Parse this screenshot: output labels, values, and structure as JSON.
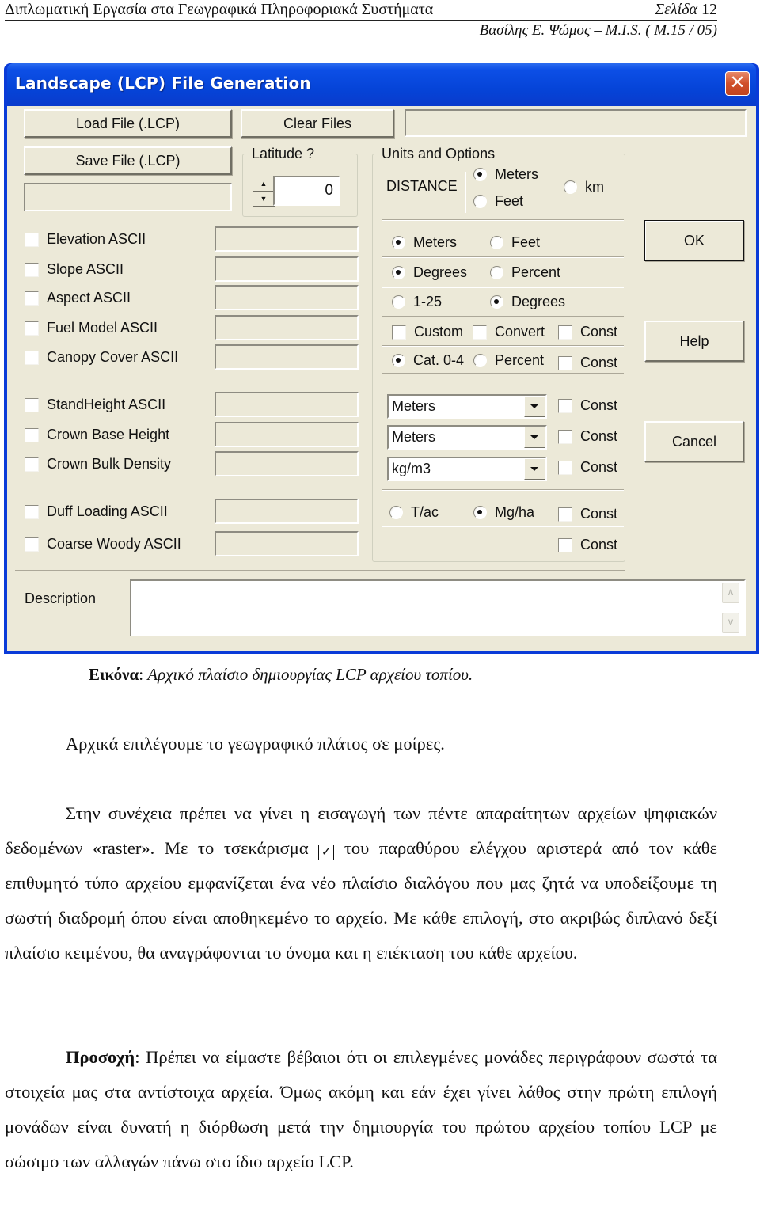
{
  "header": {
    "doc_title": "Διπλωματική Εργασία στα Γεωγραφικά Πληροφοριακά Συστήματα",
    "page_label": "Σελίδα",
    "page_number": "12",
    "author_line": "Βασίλης Ε. Ψώμος – M.I.S. ( M.15 / 05)"
  },
  "dialog": {
    "title": "Landscape (LCP) File Generation",
    "close_icon": "close-x-icon",
    "buttons": {
      "load": "Load File (.LCP)",
      "clear": "Clear Files",
      "save": "Save File (.LCP)",
      "ok": "OK",
      "help": "Help",
      "cancel": "Cancel"
    },
    "file_path_value": "",
    "status_value": "",
    "latitude": {
      "label": "Latitude ?",
      "value": "0",
      "up_icon": "spin-up-icon",
      "down_icon": "spin-down-icon"
    },
    "units": {
      "label": "Units and Options",
      "distance_label": "DISTANCE",
      "distance_options": [
        {
          "label": "Meters",
          "selected": true
        },
        {
          "label": "Feet",
          "selected": false
        },
        {
          "label": "km",
          "selected": false
        }
      ],
      "elevation": [
        {
          "label": "Meters",
          "selected": true
        },
        {
          "label": "Feet",
          "selected": false
        }
      ],
      "slope": [
        {
          "label": "Degrees",
          "selected": true
        },
        {
          "label": "Percent",
          "selected": false
        }
      ],
      "aspect": [
        {
          "label": "1-25",
          "selected": false
        },
        {
          "label": "Degrees",
          "selected": true
        }
      ],
      "fuel": [
        {
          "label": "Custom",
          "checked": false
        },
        {
          "label": "Convert",
          "checked": false
        },
        {
          "label": "Const",
          "checked": false
        }
      ],
      "canopy": {
        "options": [
          {
            "label": "Cat. 0-4",
            "selected": true
          },
          {
            "label": "Percent",
            "selected": false
          }
        ],
        "const": {
          "label": "Const",
          "checked": false
        }
      },
      "stand_height": {
        "unit": "Meters",
        "const": "Const"
      },
      "crown_base": {
        "unit": "Meters",
        "const": "Const"
      },
      "crown_bulk": {
        "unit": "kg/m3",
        "const": "Const"
      },
      "duff": {
        "options": [
          {
            "label": "T/ac",
            "selected": false
          },
          {
            "label": "Mg/ha",
            "selected": true
          }
        ],
        "const": "Const"
      },
      "coarse_woody": {
        "const": "Const"
      }
    },
    "layers": [
      {
        "label": "Elevation ASCII",
        "checked": false,
        "file": ""
      },
      {
        "label": "Slope ASCII",
        "checked": false,
        "file": ""
      },
      {
        "label": "Aspect ASCII",
        "checked": false,
        "file": ""
      },
      {
        "label": "Fuel Model ASCII",
        "checked": false,
        "file": ""
      },
      {
        "label": "Canopy Cover ASCII",
        "checked": false,
        "file": ""
      },
      {
        "label": "StandHeight ASCII",
        "checked": false,
        "file": ""
      },
      {
        "label": "Crown Base Height",
        "checked": false,
        "file": ""
      },
      {
        "label": "Crown Bulk Density",
        "checked": false,
        "file": ""
      },
      {
        "label": "Duff Loading ASCII",
        "checked": false,
        "file": ""
      },
      {
        "label": "Coarse Woody ASCII",
        "checked": false,
        "file": ""
      }
    ],
    "description": {
      "label": "Description",
      "value": "",
      "scroll_up_icon": "chevron-up-icon",
      "scroll_down_icon": "chevron-down-icon"
    }
  },
  "caption": {
    "label": "Εικόνα",
    "text": "Αρχικό  πλαίσιο δημιουργίας LCP αρχείου τοπίου."
  },
  "body": {
    "p1": "Αρχικά επιλέγουμε το γεωγραφικό πλάτος σε μοίρες.",
    "p2_a": "Στην συνέχεια πρέπει να γίνει η εισαγωγή των πέντε απαραίτητων αρχείων ψηφιακών δεδομένων «raster». Με το τσεκάρισμα",
    "p2_check_icon": "☑",
    "p2_b": "του παραθύρου ελέγχου αριστερά από τον κάθε επιθυμητό τύπο αρχείου εμφανίζεται ένα νέο πλαίσιο διαλόγου που μας ζητά να υποδείξουμε τη σωστή διαδρομή όπου είναι αποθηκεμένο το αρχείο. Με κάθε επιλογή, στο ακριβώς διπλανό δεξί πλαίσιο κειμένου, θα αναγράφονται  το όνομα και η επέκταση του κάθε αρχείου.",
    "p3_bold": "Προσοχή",
    "p3": ": Πρέπει να είμαστε βέβαιοι ότι οι επιλεγμένες μονάδες περιγράφουν σωστά τα στοιχεία μας στα αντίστοιχα αρχεία. Όμως ακόμη και εάν έχει γίνει λάθος στην πρώτη επιλογή μονάδων είναι δυνατή η διόρθωση μετά την δημιουργία του πρώτου αρχείου τοπίου LCP με σώσιμο των αλλαγών πάνω στο ίδιο αρχείο LCP."
  }
}
